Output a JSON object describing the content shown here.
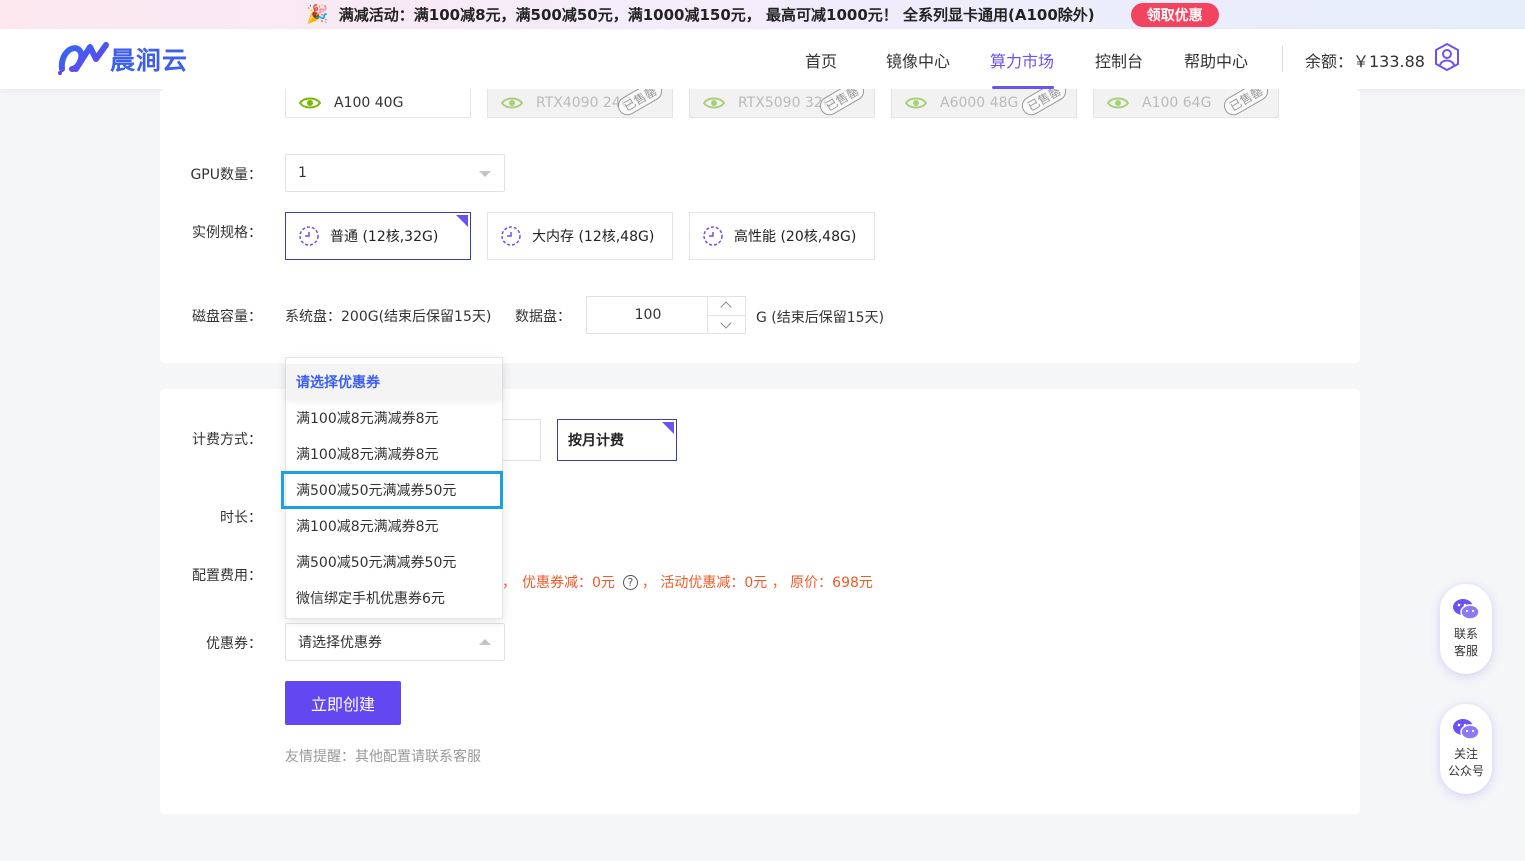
{
  "promo": {
    "text": "满减活动：满100减8元，满500减50元，满1000减150元， 最高可减1000元！ 全系列显卡通用(A100除外)",
    "claim_label": "领取优惠"
  },
  "header": {
    "logo_text": "晨涧云",
    "nav": [
      "首页",
      "镜像中心",
      "算力市场",
      "控制台",
      "帮助中心"
    ],
    "active_nav": "算力市场",
    "balance": "余额：￥133.88"
  },
  "gpu_cards": [
    {
      "name": "A100 40G",
      "sold_out": false
    },
    {
      "name": "RTX4090 24G",
      "sold_out": true
    },
    {
      "name": "RTX5090 32G",
      "sold_out": true
    },
    {
      "name": "A6000 48G",
      "sold_out": true
    },
    {
      "name": "A100 64G",
      "sold_out": true
    }
  ],
  "sold_stamp": "已售罄",
  "gpu_count": {
    "label": "GPU数量：",
    "value": "1"
  },
  "spec": {
    "label": "实例规格：",
    "options": [
      "普通 (12核,32G)",
      "大内存 (12核,48G)",
      "高性能 (20核,48G)"
    ],
    "selected": 0
  },
  "disk": {
    "label": "磁盘容量：",
    "system": "系统盘：200G(结束后保留15天)",
    "data_label": "数据盘：",
    "data_value": "100",
    "data_unit": "G (结束后保留15天)"
  },
  "billing": {
    "label": "计费方式：",
    "selected": "按月计费"
  },
  "duration": {
    "label": "时长："
  },
  "fee": {
    "label": "配置费用：",
    "prefix": "，",
    "coupon_discount": "优惠券减：0元",
    "activity": "， 活动优惠减：0元 ， 原价：698元"
  },
  "coupon": {
    "label": "优惠券：",
    "placeholder": "请选择优惠券",
    "options": [
      "请选择优惠券",
      "满100减8元满减券8元",
      "满100减8元满减券8元",
      "满500减50元满减券50元",
      "满100减8元满减券8元",
      "满500减50元满减券50元",
      "微信绑定手机优惠券6元"
    ]
  },
  "create_label": "立即创建",
  "tip": "友情提醒：其他配置请联系客服",
  "float": {
    "service": [
      "联系",
      "客服"
    ],
    "follow": [
      "关注",
      "公众号"
    ]
  },
  "colors": {
    "accent": "#6347f0",
    "link": "#3d5ff0",
    "price": "#f05a28",
    "highlight": "#1ba1e2"
  }
}
